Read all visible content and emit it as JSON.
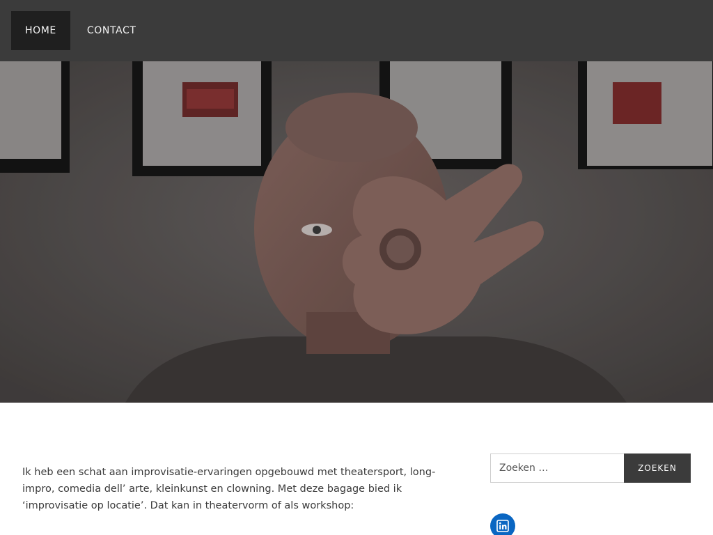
{
  "nav": {
    "items": [
      {
        "label": "HOME",
        "active": true
      },
      {
        "label": "CONTACT",
        "active": false
      }
    ]
  },
  "hero": {
    "image_alt": "Man maakt een OK-gebaar voor zijn oog"
  },
  "content": {
    "intro": "Ik heb een schat aan improvisatie-ervaringen opgebouwd met theatersport, long-impro, comedia dell’ arte, kleinkunst en clowning. Met deze bagage bied ik ‘improvisatie op locatie’. Dat kan in theatervorm of als workshop:"
  },
  "sidebar": {
    "search": {
      "placeholder": "Zoeken …",
      "button_label": "ZOEKEN"
    },
    "social": {
      "icon": "linkedin-icon"
    }
  },
  "colors": {
    "topbar": "#3b3b3b",
    "active_nav": "#1f1f1f",
    "search_button": "#3b3b3b",
    "linkedin": "#0a66c2"
  }
}
